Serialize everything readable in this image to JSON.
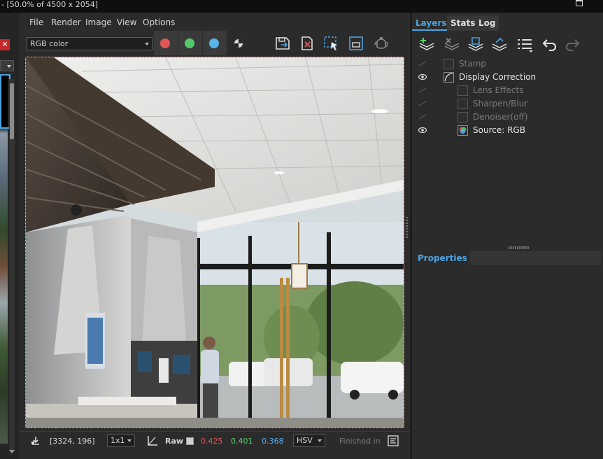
{
  "window": {
    "title": "- [50.0% of 4500 x 2054]"
  },
  "menu": [
    "File",
    "Render",
    "Image",
    "View",
    "Options"
  ],
  "toolbar": {
    "channel_select": "RGB color",
    "channel_buttons": [
      {
        "name": "red-channel-button",
        "color": "#e05555"
      },
      {
        "name": "green-channel-button",
        "color": "#55c96b"
      },
      {
        "name": "blue-channel-button",
        "color": "#55b5e8"
      }
    ],
    "icons": [
      "half-circle-icon",
      "save-image-icon",
      "clear-image-icon",
      "region-select-icon",
      "frame-view-icon",
      "teapot-render-icon"
    ]
  },
  "status": {
    "coords": "[3324, 196]",
    "zoom_select": "1x1",
    "raw_label": "Raw",
    "r": "0.425",
    "g": "0.401",
    "b": "0.368",
    "mode_select": "HSV",
    "finished": "Finished in"
  },
  "colors": {
    "accent": "#4aa3e0",
    "r_value": "#e05555",
    "g_value": "#55d36b",
    "b_value": "#55aef0"
  },
  "panel": {
    "tabs": [
      "Layers",
      "Stats",
      "Log"
    ],
    "active_tab": "Layers",
    "layer_toolbar_icons": [
      "add-layer-icon",
      "remove-layer-icon",
      "save-layer-icon",
      "load-layer-icon",
      "layer-list-icon",
      "undo-icon",
      "redo-icon"
    ],
    "layers": [
      {
        "label": "Stamp",
        "enabled": false,
        "visible": false,
        "indent": 0,
        "icon": "stamp-icon"
      },
      {
        "label": "Display Correction",
        "enabled": true,
        "visible": true,
        "indent": 0,
        "icon": "curve-icon"
      },
      {
        "label": "Lens Effects",
        "enabled": false,
        "visible": false,
        "indent": 1,
        "icon": "lens-effects-icon"
      },
      {
        "label": "Sharpen/Blur",
        "enabled": false,
        "visible": false,
        "indent": 1,
        "icon": "sharpen-icon"
      },
      {
        "label": "Denoiser(off)",
        "enabled": false,
        "visible": false,
        "indent": 1,
        "icon": "denoiser-icon"
      },
      {
        "label": "Source: RGB",
        "enabled": true,
        "visible": true,
        "indent": 1,
        "icon": "rgb-source-icon"
      }
    ],
    "properties_tab": "Properties"
  }
}
